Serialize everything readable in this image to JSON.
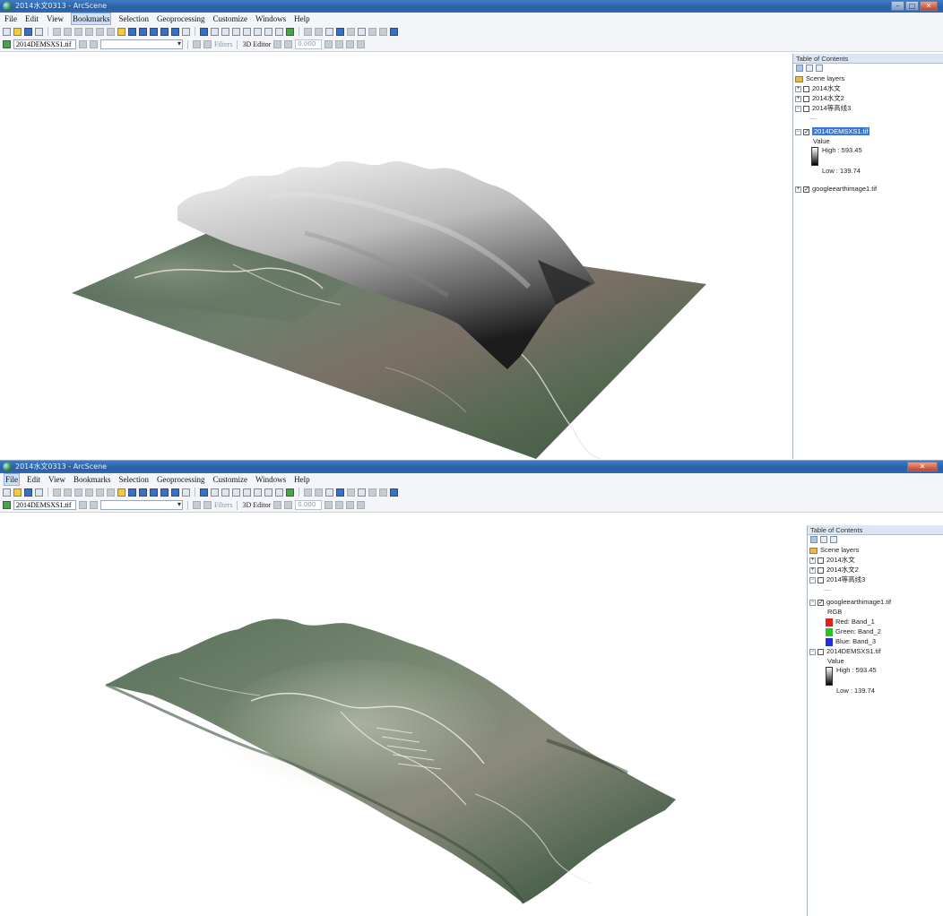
{
  "window1": {
    "title": "2014水文0313 - ArcScene",
    "menu": [
      "File",
      "Edit",
      "View",
      "Bookmarks",
      "Selection",
      "Geoprocessing",
      "Customize",
      "Windows",
      "Help"
    ],
    "active_menu": "Bookmarks",
    "layer_select": "2014DEMSXS1.tif",
    "filters_label": "Filters",
    "editor_label": "3D Editor",
    "num_value": "0.000",
    "toc": {
      "header": "Table of Contents",
      "root": "Scene layers",
      "layers": [
        "2014水文",
        "2014水文2",
        "2014等高线3"
      ],
      "dem_layer": "2014DEMSXS1.tif",
      "value_label": "Value",
      "high": "High : 593.45",
      "low": "Low : 139.74",
      "image_layer": "googleearthimage1.tif"
    }
  },
  "window2": {
    "title": "2014水文0313 - ArcScene",
    "menu": [
      "File",
      "Edit",
      "View",
      "Bookmarks",
      "Selection",
      "Geoprocessing",
      "Customize",
      "Windows",
      "Help"
    ],
    "active_menu": "File",
    "layer_select": "2014DEMSXS1.tif",
    "filters_label": "Filters",
    "editor_label": "3D Editor",
    "num_value": "0.000",
    "toc": {
      "header": "Table of Contents",
      "root": "Scene layers",
      "layers": [
        "2014水文",
        "2014水文2",
        "2014等高线3"
      ],
      "image_layer": "googleearthimage1.tif",
      "rgb_label": "RGB",
      "bands": [
        {
          "label": "Red:   Band_1",
          "color": "#e02020"
        },
        {
          "label": "Green: Band_2",
          "color": "#22c722"
        },
        {
          "label": "Blue:  Band_3",
          "color": "#2030d8"
        }
      ],
      "dem_layer": "2014DEMSXS1.tif",
      "value_label": "Value",
      "high": "High : 593.45",
      "low": "Low : 139.74"
    }
  },
  "colors": {
    "title_bar": "#2f6ab0",
    "toolbar_bg": "#f3f5f9",
    "selection": "#3a78d6"
  }
}
